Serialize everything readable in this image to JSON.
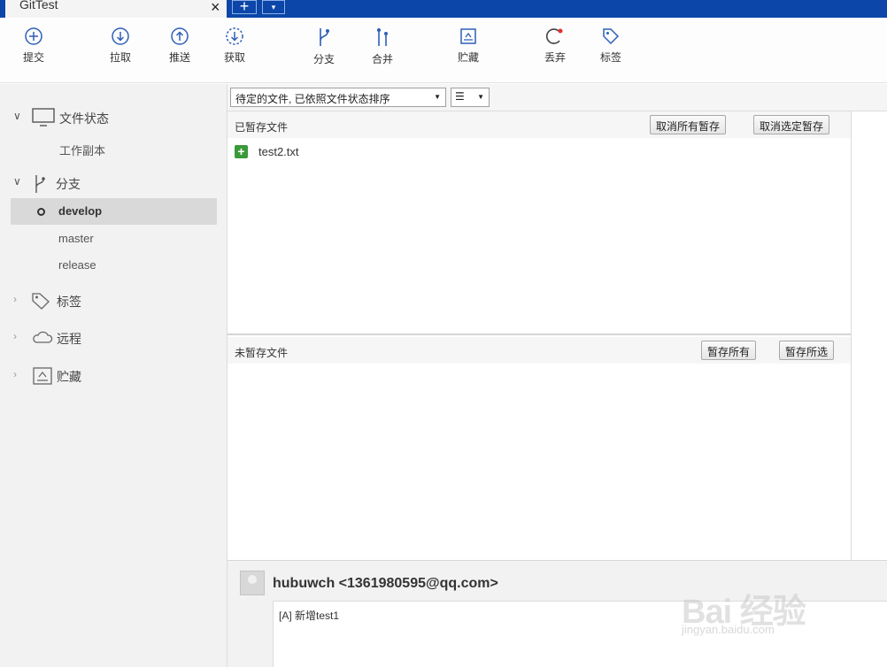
{
  "window": {
    "tab_title": "GitTest",
    "tab_close": "×",
    "new_tab": "+",
    "tab_menu": "▾"
  },
  "toolbar": {
    "items": [
      {
        "label": "提交",
        "icon": "commit-icon"
      },
      {
        "label": "拉取",
        "icon": "pull-icon"
      },
      {
        "label": "推送",
        "icon": "push-icon"
      },
      {
        "label": "获取",
        "icon": "fetch-icon"
      },
      {
        "label": "分支",
        "icon": "branch-icon"
      },
      {
        "label": "合并",
        "icon": "merge-icon"
      },
      {
        "label": "贮藏",
        "icon": "stash-icon"
      },
      {
        "label": "丢弃",
        "icon": "discard-icon"
      },
      {
        "label": "标签",
        "icon": "tag-icon"
      }
    ]
  },
  "sidebar": {
    "file_status": {
      "label": "文件状态",
      "children": [
        "工作副本"
      ]
    },
    "branches": {
      "label": "分支",
      "items": [
        "develop",
        "master",
        "release"
      ],
      "current": "develop"
    },
    "tags": {
      "label": "标签"
    },
    "remotes": {
      "label": "远程"
    },
    "stashes": {
      "label": "贮藏"
    }
  },
  "filterbar": {
    "sort_value": "待定的文件, 已依照文件状态排序",
    "view_value": "☰"
  },
  "staged": {
    "title": "已暂存文件",
    "btn_unstage_all": "取消所有暂存",
    "btn_unstage_selected": "取消选定暂存",
    "files": [
      {
        "name": "test2.txt",
        "status": "added"
      }
    ]
  },
  "unstaged": {
    "title": "未暂存文件",
    "btn_stage_all": "暂存所有",
    "btn_stage_selected": "暂存所选"
  },
  "commit": {
    "author": "hubuwch <1361980595@qq.com>",
    "message": "[A] 新增test1"
  },
  "watermark": {
    "text": "Bai 经验",
    "sub": "jingyan.baidu.com"
  },
  "colors": {
    "titlebar": "#0b46a8",
    "icon_blue": "#2e5fb8",
    "added_green": "#3a9a3a",
    "discard_red": "#e03030"
  }
}
